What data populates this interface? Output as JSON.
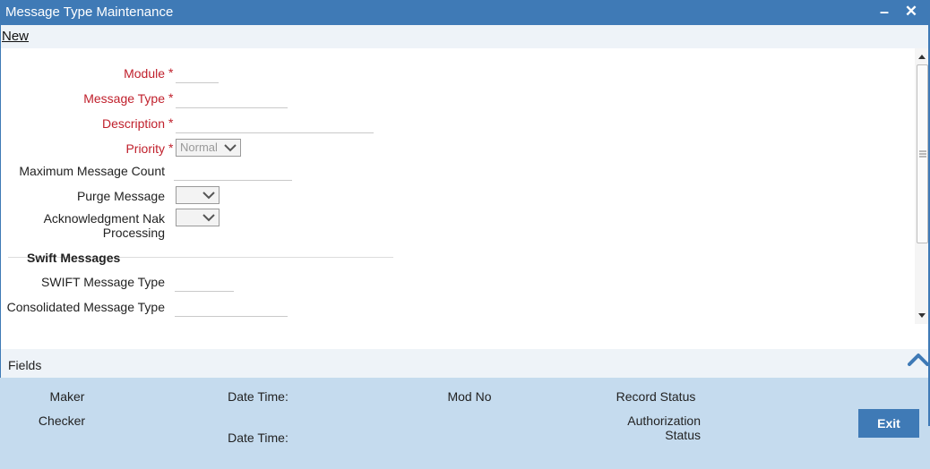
{
  "window": {
    "title": "Message Type Maintenance",
    "minimize_glyph": "–",
    "close_glyph": "✕"
  },
  "menu": {
    "new_label": "New"
  },
  "form": {
    "required_marker": "*",
    "module": {
      "label": "Module",
      "value": ""
    },
    "message_type": {
      "label": "Message Type",
      "value": ""
    },
    "description": {
      "label": "Description",
      "value": ""
    },
    "priority": {
      "label": "Priority",
      "selected": "Normal"
    },
    "max_message_count": {
      "label": "Maximum Message Count",
      "value": ""
    },
    "purge_message": {
      "label": "Purge Message",
      "selected": ""
    },
    "ack_nak_processing": {
      "label_line1": "Acknowledgment Nak",
      "label_line2": "Processing",
      "selected": ""
    },
    "swift_section": {
      "title": "Swift Messages",
      "swift_message_type": {
        "label": "SWIFT Message Type",
        "value": ""
      },
      "consolidated_message_type": {
        "label": "Consolidated Message Type",
        "value": ""
      }
    }
  },
  "fields_bar": {
    "label": "Fields",
    "toggle_icon": "chevron-up-icon"
  },
  "audit": {
    "maker": "Maker",
    "checker": "Checker",
    "date_time_1": "Date Time:",
    "date_time_2": "Date Time:",
    "mod_no": "Mod No",
    "record_status": "Record Status",
    "authorization_line1": "Authorization",
    "authorization_line2": "Status",
    "exit_label": "Exit"
  },
  "colors": {
    "titlebar": "#3f7ab6",
    "required_label": "#c0202c",
    "audit_background": "#c5dbee",
    "fields_bar_background": "#eef3f8"
  }
}
